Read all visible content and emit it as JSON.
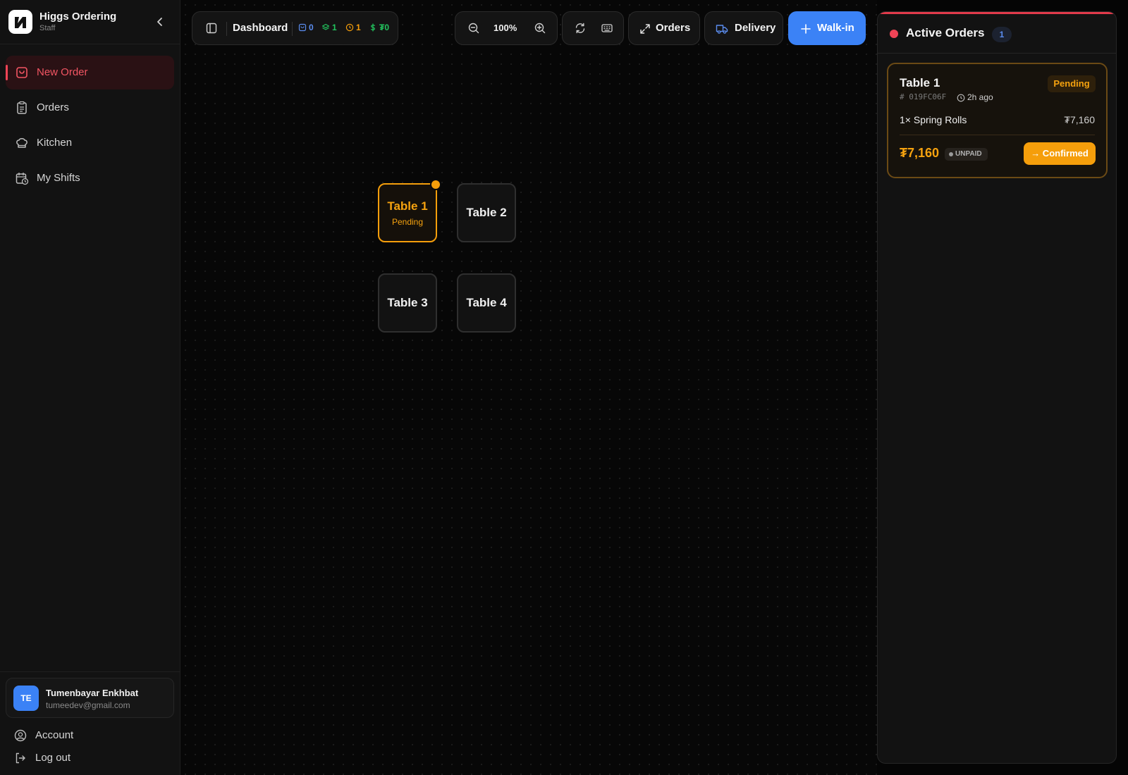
{
  "brand": {
    "title": "Higgs Ordering",
    "subtitle": "Staff"
  },
  "sidebar": {
    "items": [
      {
        "label": "New Order",
        "icon": "shopping-bag-icon",
        "active": true
      },
      {
        "label": "Orders",
        "icon": "clipboard-list-icon",
        "active": false
      },
      {
        "label": "Kitchen",
        "icon": "chef-hat-icon",
        "active": false
      },
      {
        "label": "My Shifts",
        "icon": "calendar-clock-icon",
        "active": false
      }
    ]
  },
  "user": {
    "initials": "TE",
    "name": "Tumenbayar Enkhbat",
    "email": "tumeedev@gmail.com"
  },
  "footer": {
    "account_label": "Account",
    "logout_label": "Log out"
  },
  "toolbar": {
    "title": "Dashboard",
    "stats": {
      "new": "0",
      "preparing": "1",
      "pending": "1",
      "revenue": "₮0"
    },
    "zoom": "100%",
    "orders_label": "Orders",
    "delivery_label": "Delivery",
    "walkin_label": "Walk-in"
  },
  "tables": [
    {
      "name": "Table 1",
      "status": "Pending"
    },
    {
      "name": "Table 2",
      "status": ""
    },
    {
      "name": "Table 3",
      "status": ""
    },
    {
      "name": "Table 4",
      "status": ""
    }
  ],
  "active_orders": {
    "title": "Active Orders",
    "count": "1",
    "orders": [
      {
        "table": "Table 1",
        "status": "Pending",
        "id": "019FC06F",
        "time": "2h ago",
        "item": "1× Spring Rolls",
        "item_price": "₮7,160",
        "total": "₮7,160",
        "payment": "UNPAID",
        "action": "→ Confirmed"
      }
    ]
  },
  "colors": {
    "accent_red": "#ef4456",
    "pending_amber": "#f59e0b",
    "primary_blue": "#3b82f6",
    "success_green": "#22c55e"
  }
}
